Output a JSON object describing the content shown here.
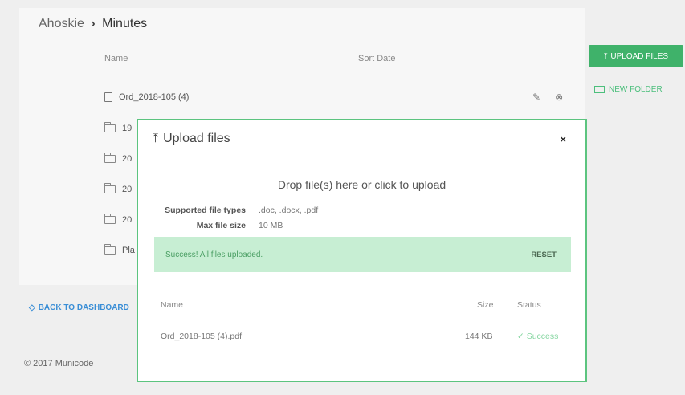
{
  "breadcrumb": {
    "parent": "Ahoskie",
    "separator": "›",
    "current": "Minutes"
  },
  "file_list": {
    "columns": {
      "name": "Name",
      "sort_date": "Sort Date"
    },
    "rows": [
      {
        "name": "Ord_2018-105 (4)",
        "type": "file"
      },
      {
        "name": "19",
        "type": "folder"
      },
      {
        "name": "20",
        "type": "folder"
      },
      {
        "name": "20",
        "type": "folder"
      },
      {
        "name": "20",
        "type": "folder"
      },
      {
        "name": "Pla",
        "type": "folder"
      }
    ]
  },
  "actions": {
    "upload_label": "UPLOAD FILES",
    "new_folder_label": "NEW FOLDER"
  },
  "back_link": "BACK TO DASHBOARD",
  "footer": "© 2017 Municode",
  "modal": {
    "title": "Upload files",
    "close": "×",
    "drop_text": "Drop file(s) here or click to upload",
    "supported_label": "Supported file types",
    "supported_value": ".doc, .docx, .pdf",
    "max_size_label": "Max file size",
    "max_size_value": "10 MB",
    "success_message": "Success! All files uploaded.",
    "reset_label": "RESET",
    "table": {
      "headers": {
        "name": "Name",
        "size": "Size",
        "status": "Status"
      },
      "rows": [
        {
          "name": "Ord_2018-105 (4).pdf",
          "size": "144 KB",
          "status": "✓ Success"
        }
      ]
    }
  },
  "colors": {
    "accent_green": "#3fb26a",
    "modal_border": "#5cc47f",
    "success_bg": "#c7eed3",
    "link_blue": "#3a8ed6"
  }
}
